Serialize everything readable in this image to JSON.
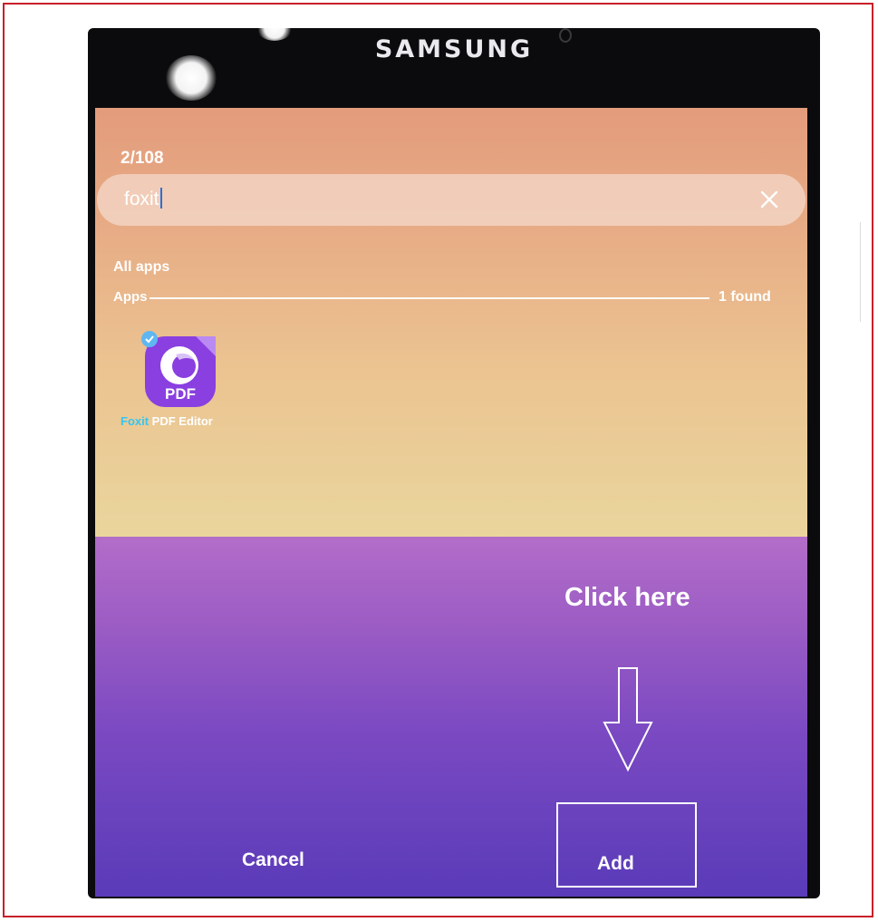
{
  "device": {
    "brand": "SAMSUNG"
  },
  "screen": {
    "counter": "2/108",
    "search": {
      "value": "foxit",
      "clear_icon": "close-icon"
    },
    "section_title": "All apps",
    "apps_header": {
      "label": "Apps",
      "count": "1 found"
    },
    "results": [
      {
        "icon": "foxit-pdf-icon",
        "icon_text": "PDF",
        "label_highlight": "Foxit",
        "label_rest": " PDF Editor",
        "selected": true
      }
    ],
    "annotation": {
      "hint": "Click here",
      "arrow_icon": "arrow-down-icon"
    },
    "actions": {
      "cancel_label": "Cancel",
      "add_label": "Add"
    }
  },
  "colors": {
    "frame_border": "#c8202a",
    "upper_gradient_top": "#e39c7c",
    "upper_gradient_bottom": "#ead59d",
    "lower_gradient_top": "#b36dc9",
    "lower_gradient_bottom": "#5a3bb8",
    "search_highlight": "#35c6f0",
    "app_icon": "#8a3fe0"
  }
}
